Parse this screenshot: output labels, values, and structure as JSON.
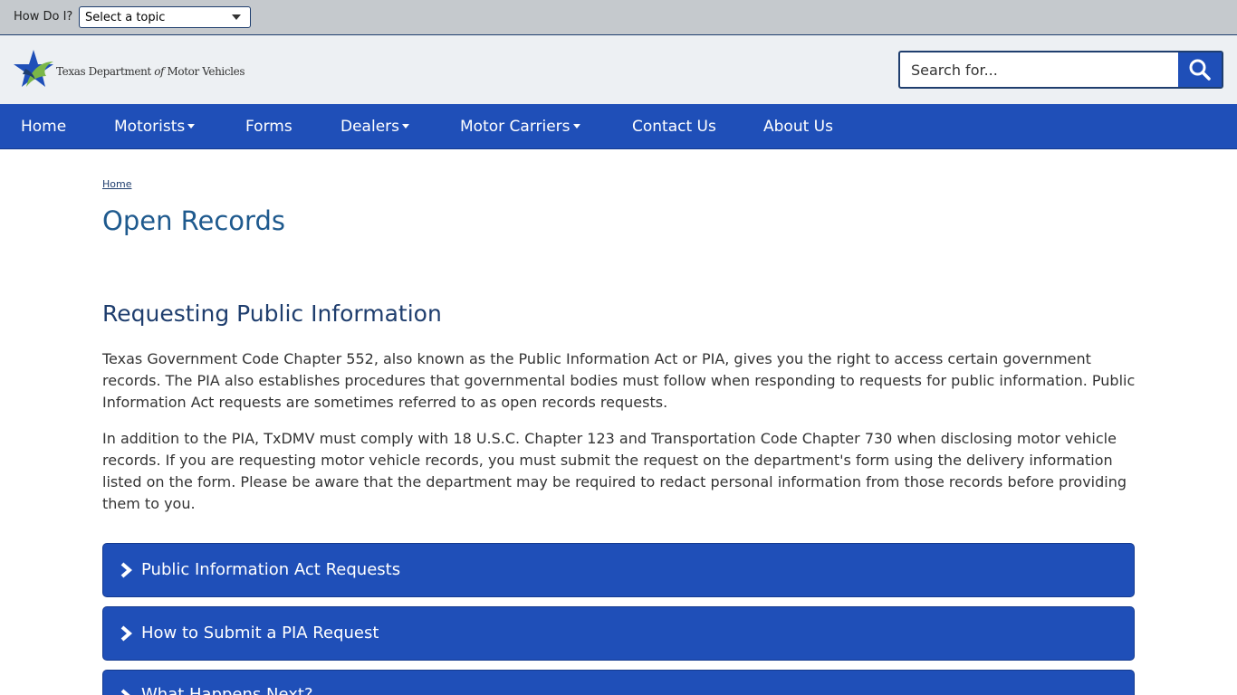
{
  "topbar": {
    "label": "How Do I?",
    "topic_select_value": "Select a topic"
  },
  "header": {
    "logo_text_pre": "Texas Department ",
    "logo_text_of": "of",
    "logo_text_post": " Motor Vehicles",
    "search_placeholder": "Search for..."
  },
  "nav": {
    "items": [
      {
        "label": "Home"
      },
      {
        "label": "Motorists"
      },
      {
        "label": "Forms"
      },
      {
        "label": "Dealers"
      },
      {
        "label": "Motor Carriers"
      },
      {
        "label": "Contact Us"
      },
      {
        "label": "About Us"
      }
    ]
  },
  "breadcrumb": {
    "home": "Home"
  },
  "page": {
    "title": "Open Records",
    "section_title": "Requesting Public Information",
    "paragraphs": [
      "Texas Government Code Chapter 552, also known as the Public Information Act or PIA, gives you the right to access certain government records. The PIA also establishes procedures that governmental bodies must follow when responding to requests for public information. Public Information Act requests are sometimes referred to as open records requests.",
      "In addition to the PIA, TxDMV must comply with 18 U.S.C. Chapter 123 and Transportation Code Chapter 730 when disclosing motor vehicle records. If you are requesting motor vehicle records, you must submit the request on the department's form using the delivery information listed on the form. Please be aware that the department may be required to redact personal information from those records before providing them to you."
    ],
    "accordions": [
      {
        "label": "Public Information Act Requests"
      },
      {
        "label": "How to Submit a PIA Request"
      },
      {
        "label": "What Happens Next?"
      }
    ]
  },
  "colors": {
    "brand_blue": "#1f4fb8",
    "dark_navy": "#1f3e6e",
    "title_blue": "#1f5a8e",
    "topbar_gray": "#c5c9cd",
    "header_bg": "#edf0f3",
    "logo_green": "#7ab648"
  }
}
